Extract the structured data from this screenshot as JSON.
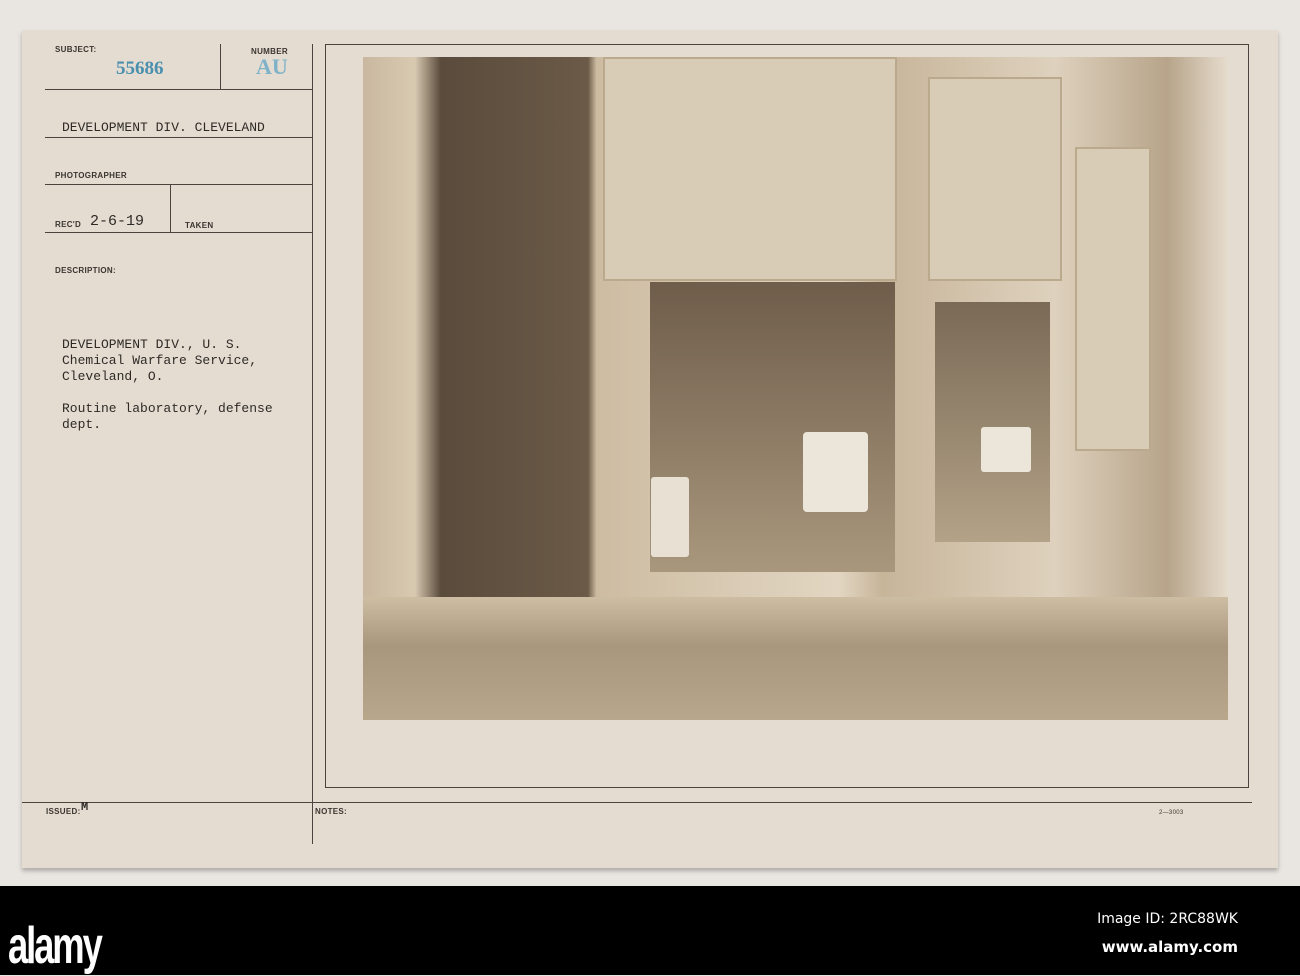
{
  "card": {
    "subject_label": "SUBJECT:",
    "subject_number": "55686",
    "number_label": "NUMBER",
    "number_value": "AU",
    "title": "DEVELOPMENT DIV. CLEVELAND",
    "photographer_label": "PHOTOGRAPHER",
    "recd_label": "REC'D",
    "recd_date": "2-6-19",
    "taken_label": "TAKEN",
    "description_label": "DESCRIPTION:",
    "description": "DEVELOPMENT DIV., U. S.\nChemical Warfare Service,\nCleveland, O.\n\nRoutine laboratory, defense\ndept.",
    "issued_label": "ISSUED:",
    "issued_value": "M",
    "notes_label": "NOTES:",
    "form_code": "2—3003"
  },
  "colors": {
    "stamp_blue": "#4a8fae",
    "card": "#e4dcd1"
  },
  "footer": {
    "logo": "alamy",
    "image_id": "Image ID: 2RC88WK",
    "url": "www.alamy.com"
  }
}
